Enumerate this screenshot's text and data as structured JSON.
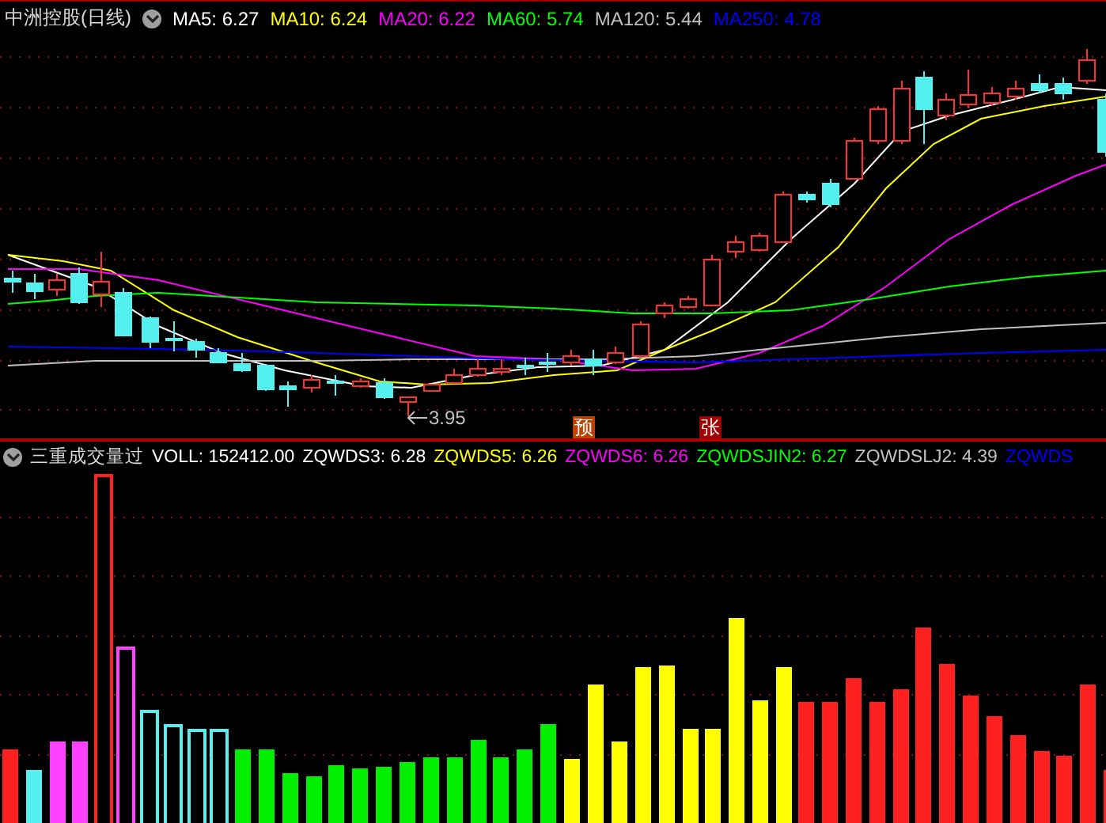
{
  "main_chart": {
    "title": "中洲控股(日线)",
    "legend": [
      {
        "label": "MA5: 6.27",
        "color": "#ffffff"
      },
      {
        "label": "MA10: 6.24",
        "color": "#ffff00"
      },
      {
        "label": "MA20: 6.22",
        "color": "#ff00ff"
      },
      {
        "label": "MA60: 5.74",
        "color": "#00ff00"
      },
      {
        "label": "MA120: 5.44",
        "color": "#c0c0c0"
      },
      {
        "label": "MA250: 4.78",
        "color": "#0000ff"
      }
    ],
    "low_price_label": "3.95",
    "markers": [
      {
        "text": "预",
        "color": "#c04000"
      },
      {
        "text": "张",
        "color": "#a00000"
      }
    ]
  },
  "volume_chart": {
    "title": "三重成交量过",
    "legend": [
      {
        "label": "VOLL: 152412.00",
        "color": "#ffffff"
      },
      {
        "label": "ZQWDS3: 6.28",
        "color": "#ffffff"
      },
      {
        "label": "ZQWDS5: 6.26",
        "color": "#ffff00"
      },
      {
        "label": "ZQWDS6: 6.26",
        "color": "#ff00ff"
      },
      {
        "label": "ZQWDSJIN2: 6.27",
        "color": "#00ff00"
      },
      {
        "label": "ZQWDSLJ2: 4.39",
        "color": "#c0c0c0"
      },
      {
        "label": "ZQWDS",
        "color": "#0000ff"
      }
    ]
  }
}
